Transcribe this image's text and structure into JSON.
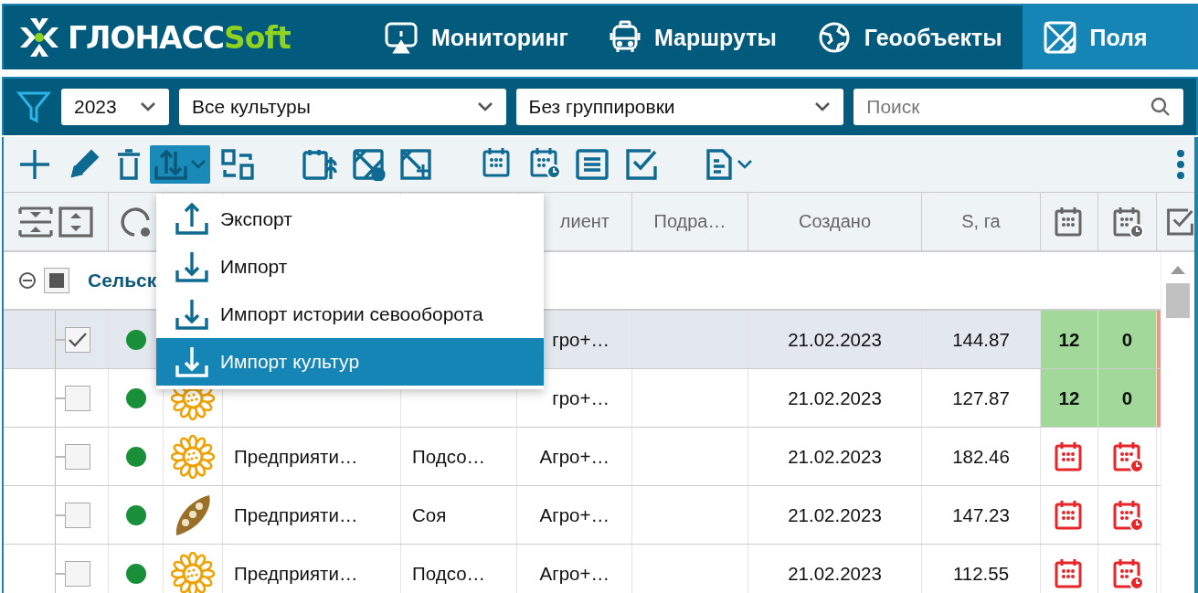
{
  "logo": {
    "main": "ГЛОНАСС",
    "accent": "Soft"
  },
  "nav": [
    {
      "label": "Мониторинг",
      "kind": "monitor",
      "selected": false
    },
    {
      "label": "Маршруты",
      "kind": "bus",
      "selected": false
    },
    {
      "label": "Геообъекты",
      "kind": "globe",
      "selected": false
    },
    {
      "label": "Поля",
      "kind": "field",
      "selected": true
    }
  ],
  "filters": {
    "year": "2023",
    "crop": "Все культуры",
    "grouping": "Без группировки",
    "search_placeholder": "Поиск"
  },
  "toolbar": {
    "export_open": true
  },
  "menu": {
    "items": [
      {
        "label": "Экспорт",
        "kind": "upload",
        "selected": false
      },
      {
        "label": "Импорт",
        "kind": "download",
        "selected": false
      },
      {
        "label": "Импорт истории севооборота",
        "kind": "download",
        "selected": false
      },
      {
        "label": "Импорт культур",
        "kind": "download",
        "selected": true
      }
    ]
  },
  "header": {
    "client": "лиент",
    "division": "Подра…",
    "created": "Создано",
    "area": "S, га"
  },
  "group": {
    "label": "Сельск",
    "expanded": true,
    "partially_checked": true
  },
  "rows": [
    {
      "selected": true,
      "checked": true,
      "color": "#1a8f3a",
      "client": "гро+…",
      "created": "21.02.2023",
      "area": "144.87",
      "schedule": {
        "kind": "counts",
        "plan": "12",
        "fact": "0"
      }
    },
    {
      "selected": false,
      "checked": false,
      "color": "#1a8f3a",
      "crop_icon": {
        "kind": "sunflower"
      },
      "client": "гро+…",
      "created": "21.02.2023",
      "area": "127.87",
      "schedule": {
        "kind": "counts",
        "plan": "12",
        "fact": "0"
      }
    },
    {
      "selected": false,
      "checked": false,
      "color": "#1a8f3a",
      "crop_icon": {
        "kind": "sunflower"
      },
      "name": "Предприяти…",
      "crop": "Подсо…",
      "client": "Агро+…",
      "created": "21.02.2023",
      "area": "182.46",
      "schedule": {
        "kind": "missing"
      }
    },
    {
      "selected": false,
      "checked": false,
      "color": "#1a8f3a",
      "crop_icon": {
        "kind": "soy"
      },
      "name": "Предприяти…",
      "crop": "Соя",
      "client": "Агро+…",
      "created": "21.02.2023",
      "area": "147.23",
      "schedule": {
        "kind": "missing"
      }
    },
    {
      "selected": false,
      "checked": false,
      "color": "#1a8f3a",
      "crop_icon": {
        "kind": "sunflower"
      },
      "name": "Предприяти…",
      "crop": "Подсо…",
      "client": "Агро+…",
      "created": "21.02.2023",
      "area": "112.55",
      "schedule": {
        "kind": "missing"
      }
    }
  ]
}
